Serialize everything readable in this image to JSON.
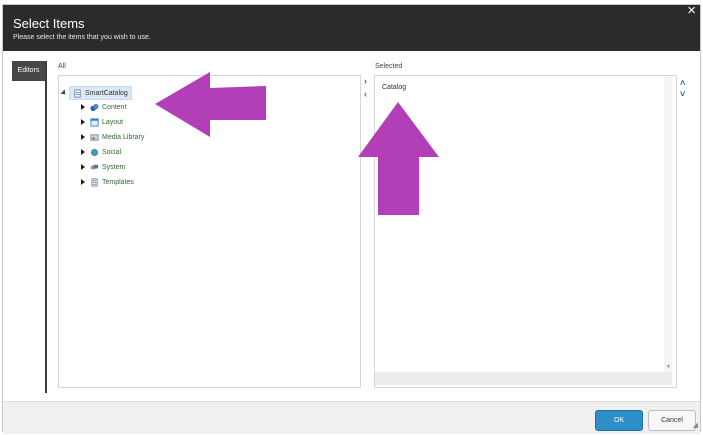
{
  "dialog": {
    "title": "Select Items",
    "subtitle": "Please select the items that you wish to use.",
    "close_icon": "×"
  },
  "sidebar": {
    "tab_label": "Editors"
  },
  "all_panel": {
    "label": "All",
    "root": "SmartCatalog",
    "items": [
      {
        "label": "Content",
        "icon": "content-icon"
      },
      {
        "label": "Layout",
        "icon": "layout-icon"
      },
      {
        "label": "Media Library",
        "icon": "media-library-icon"
      },
      {
        "label": "Social",
        "icon": "social-icon"
      },
      {
        "label": "System",
        "icon": "system-icon"
      },
      {
        "label": "Templates",
        "icon": "templates-icon"
      }
    ]
  },
  "selected_panel": {
    "label": "Selected",
    "items": [
      "Catalog"
    ]
  },
  "controls": {
    "add_glyph": "›",
    "remove_glyph": "‹",
    "up_glyph": "˄",
    "down_glyph": "˅"
  },
  "footer": {
    "ok_label": "OK",
    "cancel_label": "Cancel"
  },
  "colors": {
    "header": "#2b2b2b",
    "ok_button": "#2e8fc8",
    "arrow_annotation": "#b23fb7"
  }
}
